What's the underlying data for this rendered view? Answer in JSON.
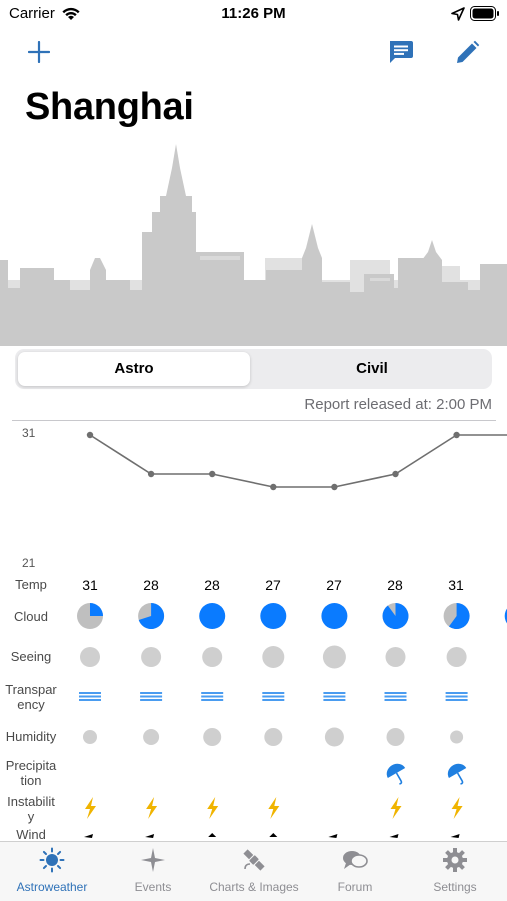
{
  "status_bar": {
    "carrier": "Carrier",
    "time": "11:26 PM"
  },
  "nav": {
    "add_icon": "plus-icon",
    "comments_icon": "comment-icon",
    "edit_icon": "pencil-icon"
  },
  "city": "Shanghai",
  "segments": {
    "astro": "Astro",
    "civil": "Civil",
    "selected": "Astro"
  },
  "report": "Report released at: 2:00 PM",
  "chart_data": {
    "type": "line",
    "ylim": [
      21,
      31
    ],
    "ytick_labels": [
      "31",
      "21"
    ],
    "x": [
      1,
      2,
      3,
      4,
      5,
      6,
      7
    ],
    "values": [
      31,
      28,
      28,
      27,
      27,
      28,
      31
    ]
  },
  "rows": {
    "temp": {
      "label": "Temp",
      "values": [
        "31",
        "28",
        "28",
        "27",
        "27",
        "28",
        "31"
      ]
    },
    "cloud": {
      "label": "Cloud",
      "fractions": [
        0.25,
        0.7,
        1.0,
        1.0,
        1.0,
        0.9,
        0.6
      ]
    },
    "seeing": {
      "label": "Seeing"
    },
    "transparency": {
      "label": "Transpar\nency"
    },
    "humidity": {
      "label": "Humidity"
    },
    "precipitation": {
      "label": "Precipita\ntion",
      "umbrella_columns": [
        6,
        7
      ]
    },
    "instability": {
      "label": "Instabilit\ny",
      "lightning_columns": [
        1,
        2,
        3,
        4,
        6,
        7
      ]
    },
    "wind": {
      "label": "Wind"
    }
  },
  "colors": {
    "accent": "#2f72b8",
    "cloud_blue": "#0a7bff",
    "grey": "#bfbfbf",
    "transparency": "#4a9cf0",
    "lightning": "#f0b400"
  },
  "tabs": [
    {
      "label": "Astroweather",
      "icon": "sun-icon",
      "active": true
    },
    {
      "label": "Events",
      "icon": "sparkle-icon",
      "active": false
    },
    {
      "label": "Charts & Images",
      "icon": "satellite-icon",
      "active": false
    },
    {
      "label": "Forum",
      "icon": "chat-bubbles-icon",
      "active": false
    },
    {
      "label": "Settings",
      "icon": "gear-icon",
      "active": false
    }
  ]
}
